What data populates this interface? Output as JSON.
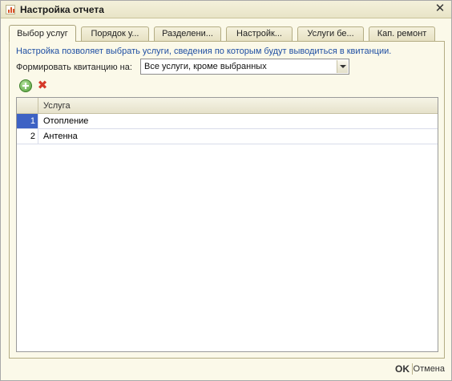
{
  "window": {
    "title": "Настройка отчета",
    "close_glyph": "✕"
  },
  "tabs": [
    {
      "label": "Выбор услуг",
      "active": true
    },
    {
      "label": "Порядок у...",
      "active": false
    },
    {
      "label": "Разделени...",
      "active": false
    },
    {
      "label": "Настройк...",
      "active": false
    },
    {
      "label": "Услуги бе...",
      "active": false
    },
    {
      "label": "Кап. ремонт",
      "active": false
    }
  ],
  "panel": {
    "info_text": "Настройка позволяет выбрать услуги, сведения по которым будут выводиться в квитанции.",
    "form_label": "Формировать квитанцию на:",
    "select_value": "Все услуги, кроме выбранных"
  },
  "toolbar": {
    "add_icon": "add-icon",
    "delete_icon": "delete-icon",
    "delete_glyph": "✖"
  },
  "table": {
    "column_header": "Услуга",
    "rows": [
      {
        "num": "1",
        "name": "Отопление",
        "selected": true
      },
      {
        "num": "2",
        "name": "Антенна",
        "selected": false
      }
    ]
  },
  "footer": {
    "ok_label": "OK",
    "cancel_label": "Отмена"
  }
}
